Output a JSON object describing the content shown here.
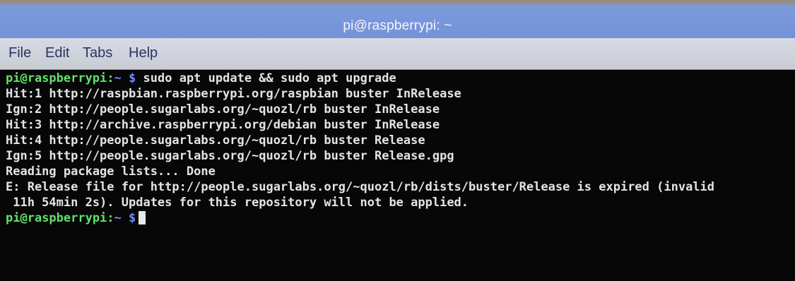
{
  "window": {
    "title": "pi@raspberrypi: ~"
  },
  "menu": {
    "items": [
      "File",
      "Edit",
      "Tabs",
      "Help"
    ]
  },
  "terminal": {
    "prompt": {
      "user_host": "pi@raspberrypi:",
      "path": "~",
      "dollar": "$"
    },
    "command": "sudo apt update && sudo apt upgrade",
    "output_lines": [
      "Hit:1 http://raspbian.raspberrypi.org/raspbian buster InRelease",
      "Ign:2 http://people.sugarlabs.org/~quozl/rb buster InRelease",
      "Hit:3 http://archive.raspberrypi.org/debian buster InRelease",
      "Hit:4 http://people.sugarlabs.org/~quozl/rb buster Release",
      "Ign:5 http://people.sugarlabs.org/~quozl/rb buster Release.gpg",
      "Reading package lists... Done",
      "E: Release file for http://people.sugarlabs.org/~quozl/rb/dists/buster/Release is expired (invalid",
      " 11h 54min 2s). Updates for this repository will not be applied."
    ]
  },
  "colors": {
    "title_bar": "#7a98de",
    "menu_bar": "#d2d5dc",
    "terminal_bg": "#070707",
    "prompt_user": "#62e06a",
    "prompt_path": "#6f8cff",
    "text": "#e4e4e6"
  }
}
